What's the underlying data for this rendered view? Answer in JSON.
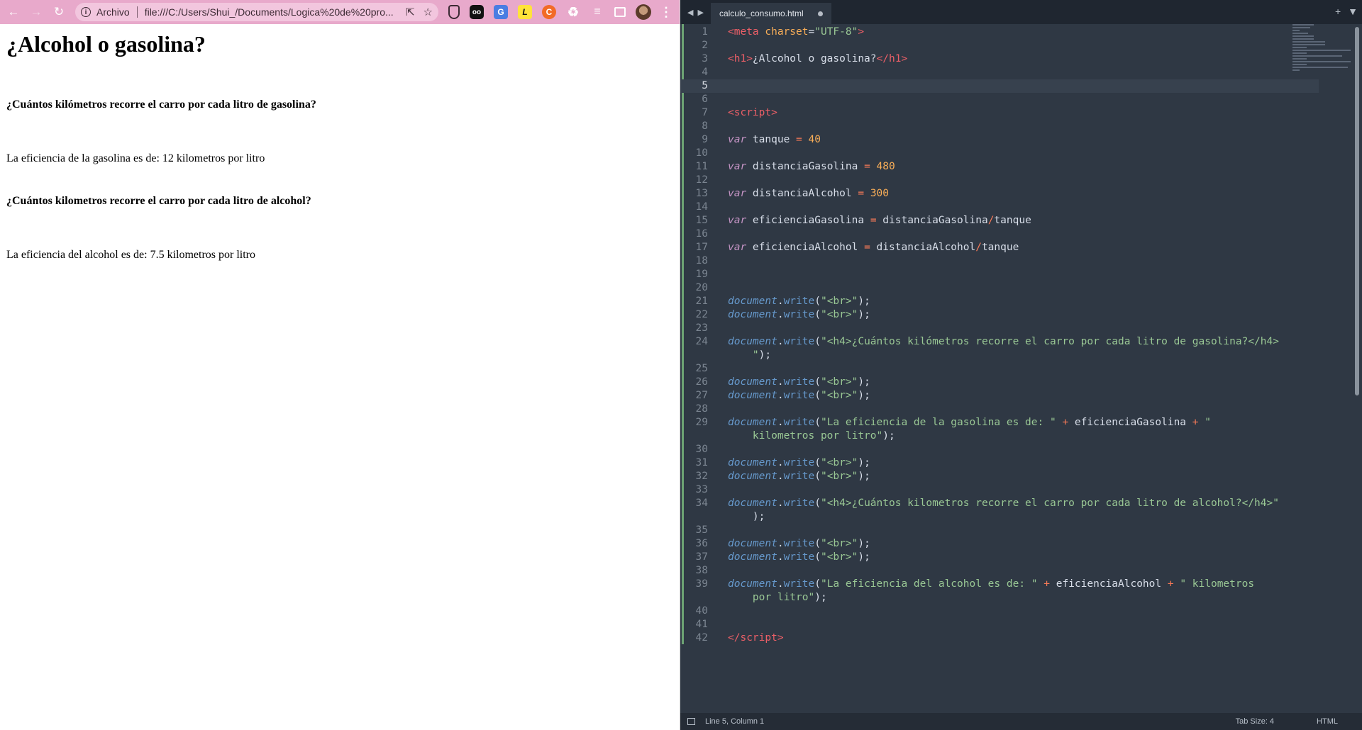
{
  "browser": {
    "url_scheme_label": "Archivo",
    "url": "file:///C:/Users/Shui_/Documents/Logica%20de%20pro...",
    "page": {
      "title": "¿Alcohol o gasolina?",
      "question_gasoline": "¿Cuántos kilómetros recorre el carro por cada litro de gasolina?",
      "result_gasoline": "La eficiencia de la gasolina es de: 12 kilometros por litro",
      "question_alcohol": "¿Cuántos kilometros recorre el carro por cada litro de alcohol?",
      "result_alcohol": "La eficiencia del alcohol es de: 7.5 kilometros por litro"
    }
  },
  "editor": {
    "tab_filename": "calculo_consumo.html",
    "code_lines": [
      {
        "n": "1",
        "html": "<span class=\"tag\">&lt;meta</span> <span class=\"attr\">charset</span><span class=\"punct\">=</span><span class=\"str\">\"UTF-8\"</span><span class=\"tag\">&gt;</span>"
      },
      {
        "n": "2",
        "html": ""
      },
      {
        "n": "3",
        "html": "<span class=\"tag\">&lt;h1&gt;</span>¿Alcohol o gasolina?<span class=\"tag\">&lt;/h1&gt;</span>"
      },
      {
        "n": "4",
        "html": ""
      },
      {
        "n": "5",
        "html": "",
        "active": true
      },
      {
        "n": "6",
        "html": ""
      },
      {
        "n": "7",
        "html": "<span class=\"tag\">&lt;script&gt;</span>"
      },
      {
        "n": "8",
        "html": ""
      },
      {
        "n": "9",
        "html": "<span class=\"kw\">var</span> tanque <span class=\"op\">=</span> <span class=\"num\">40</span>"
      },
      {
        "n": "10",
        "html": ""
      },
      {
        "n": "11",
        "html": "<span class=\"kw\">var</span> distanciaGasolina <span class=\"op\">=</span> <span class=\"num\">480</span>"
      },
      {
        "n": "12",
        "html": ""
      },
      {
        "n": "13",
        "html": "<span class=\"kw\">var</span> distanciaAlcohol <span class=\"op\">=</span> <span class=\"num\">300</span>"
      },
      {
        "n": "14",
        "html": ""
      },
      {
        "n": "15",
        "html": "<span class=\"kw\">var</span> eficienciaGasolina <span class=\"op\">=</span> distanciaGasolina<span class=\"op\">/</span>tanque"
      },
      {
        "n": "16",
        "html": ""
      },
      {
        "n": "17",
        "html": "<span class=\"kw\">var</span> eficienciaAlcohol <span class=\"op\">=</span> distanciaAlcohol<span class=\"op\">/</span>tanque"
      },
      {
        "n": "18",
        "html": ""
      },
      {
        "n": "19",
        "html": ""
      },
      {
        "n": "20",
        "html": ""
      },
      {
        "n": "21",
        "html": "<span class=\"obj\">document</span>.<span class=\"meth\">write</span>(<span class=\"str\">\"&lt;br&gt;\"</span>);"
      },
      {
        "n": "22",
        "html": "<span class=\"obj\">document</span>.<span class=\"meth\">write</span>(<span class=\"str\">\"&lt;br&gt;\"</span>);"
      },
      {
        "n": "23",
        "html": ""
      },
      {
        "n": "24",
        "html": "<span class=\"obj\">document</span>.<span class=\"meth\">write</span>(<span class=\"str\">\"&lt;h4&gt;¿Cuántos kilómetros recorre el carro por cada litro de gasolina?&lt;/h4&gt;</span>"
      },
      {
        "n": "",
        "html": "    <span class=\"str\">\"</span>);",
        "cont": true
      },
      {
        "n": "25",
        "html": ""
      },
      {
        "n": "26",
        "html": "<span class=\"obj\">document</span>.<span class=\"meth\">write</span>(<span class=\"str\">\"&lt;br&gt;\"</span>);"
      },
      {
        "n": "27",
        "html": "<span class=\"obj\">document</span>.<span class=\"meth\">write</span>(<span class=\"str\">\"&lt;br&gt;\"</span>);"
      },
      {
        "n": "28",
        "html": ""
      },
      {
        "n": "29",
        "html": "<span class=\"obj\">document</span>.<span class=\"meth\">write</span>(<span class=\"str\">\"La eficiencia de la gasolina es de: \"</span> <span class=\"op\">+</span> eficienciaGasolina <span class=\"op\">+</span> <span class=\"str\">\"</span>"
      },
      {
        "n": "",
        "html": "    <span class=\"str\">kilometros por litro\"</span>);",
        "cont": true
      },
      {
        "n": "30",
        "html": ""
      },
      {
        "n": "31",
        "html": "<span class=\"obj\">document</span>.<span class=\"meth\">write</span>(<span class=\"str\">\"&lt;br&gt;\"</span>);"
      },
      {
        "n": "32",
        "html": "<span class=\"obj\">document</span>.<span class=\"meth\">write</span>(<span class=\"str\">\"&lt;br&gt;\"</span>);"
      },
      {
        "n": "33",
        "html": ""
      },
      {
        "n": "34",
        "html": "<span class=\"obj\">document</span>.<span class=\"meth\">write</span>(<span class=\"str\">\"&lt;h4&gt;¿Cuántos kilometros recorre el carro por cada litro de alcohol?&lt;/h4&gt;\"</span>"
      },
      {
        "n": "",
        "html": "    );",
        "cont": true
      },
      {
        "n": "35",
        "html": ""
      },
      {
        "n": "36",
        "html": "<span class=\"obj\">document</span>.<span class=\"meth\">write</span>(<span class=\"str\">\"&lt;br&gt;\"</span>);"
      },
      {
        "n": "37",
        "html": "<span class=\"obj\">document</span>.<span class=\"meth\">write</span>(<span class=\"str\">\"&lt;br&gt;\"</span>);"
      },
      {
        "n": "38",
        "html": ""
      },
      {
        "n": "39",
        "html": "<span class=\"obj\">document</span>.<span class=\"meth\">write</span>(<span class=\"str\">\"La eficiencia del alcohol es de: \"</span> <span class=\"op\">+</span> eficienciaAlcohol <span class=\"op\">+</span> <span class=\"str\">\" kilometros</span>"
      },
      {
        "n": "",
        "html": "    <span class=\"str\">por litro\"</span>);",
        "cont": true
      },
      {
        "n": "40",
        "html": ""
      },
      {
        "n": "41",
        "html": ""
      },
      {
        "n": "42",
        "html": "<span class=\"tag\">&lt;/script&gt;</span>"
      }
    ],
    "status": {
      "position": "Line 5, Column 1",
      "tab_size": "Tab Size: 4",
      "syntax": "HTML"
    }
  }
}
